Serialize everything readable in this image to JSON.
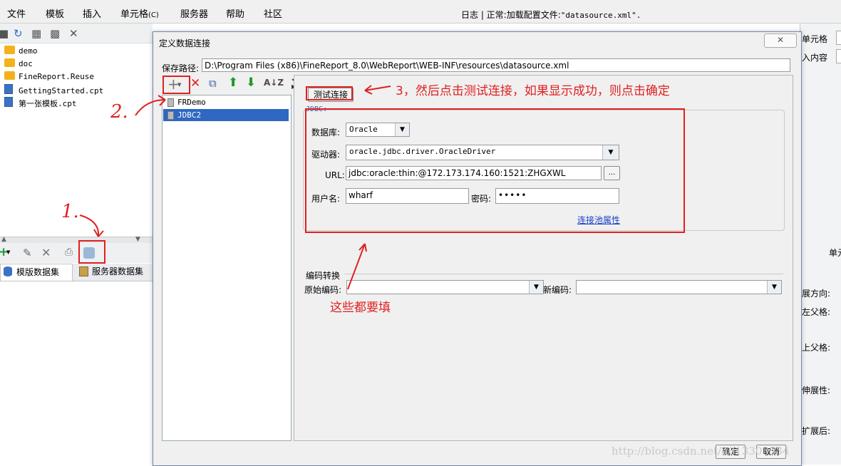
{
  "menubar": {
    "items": [
      "文件",
      "模板",
      "插入",
      "单元格",
      "服务器",
      "帮助",
      "社区"
    ],
    "cell_shortcut": "(C)",
    "status_prefix": "日志 | 正常:加载配置文件:",
    "status_file": "\"datasource.xml\"."
  },
  "file_list": {
    "items": [
      {
        "name": "demo",
        "type": "folder"
      },
      {
        "name": "doc",
        "type": "folder"
      },
      {
        "name": "FineReport.Reuse",
        "type": "folder"
      },
      {
        "name": "GettingStarted.cpt",
        "type": "file"
      },
      {
        "name": "第一张模板.cpt",
        "type": "file"
      }
    ]
  },
  "dataset_tabs": {
    "template": "模版数据集",
    "server": "服务器数据集"
  },
  "right_pane": {
    "cell_label": "单元格",
    "insert_content": "入内容",
    "cell_short": "单元",
    "expand_dir": "展方向:",
    "left_parent": "左父格:",
    "top_parent": "上父格:",
    "extend_attr": "伸展性:",
    "extend_after": "扩展后:"
  },
  "dialog": {
    "title": "定义数据连接",
    "close_glyph": "✕",
    "path_label": "保存路径:",
    "path_value": "D:\\Program Files (x86)\\FineReport_8.0\\WebReport\\WEB-INF\\resources\\datasource.xml",
    "connections": [
      "FRDemo",
      "JDBC2"
    ],
    "selected_connection": "JDBC2",
    "test_button": "测试连接",
    "jdbc_legend": "JDBC:",
    "db_label": "数据库:",
    "db_value": "Oracle",
    "driver_label": "驱动器:",
    "driver_value": "oracle.jdbc.driver.OracleDriver",
    "url_label": "URL:",
    "url_value": "jdbc:oracle:thin:@172.173.174.160:1521:ZHGXWL",
    "url_more": "...",
    "user_label": "用户名:",
    "user_value": "wharf",
    "password_label": "密码:",
    "password_value": "•••••",
    "pool_link": "连接池属性",
    "encoding_legend": "编码转换",
    "orig_enc_label": "原始编码:",
    "new_enc_label": "新编码:",
    "ok_button": "确定",
    "cancel_button": "取消"
  },
  "annotations": {
    "step3": "3，然后点击测试连接，如果显示成功，则点击确定",
    "fill_note": "这些都要填",
    "step2": "2.",
    "step1": "1."
  },
  "watermark": "http://blog.csdn.net/u013303534",
  "colors": {
    "annotation_red": "#e02020",
    "selection_blue": "#2f67c2",
    "link_blue": "#1a3fc8"
  }
}
